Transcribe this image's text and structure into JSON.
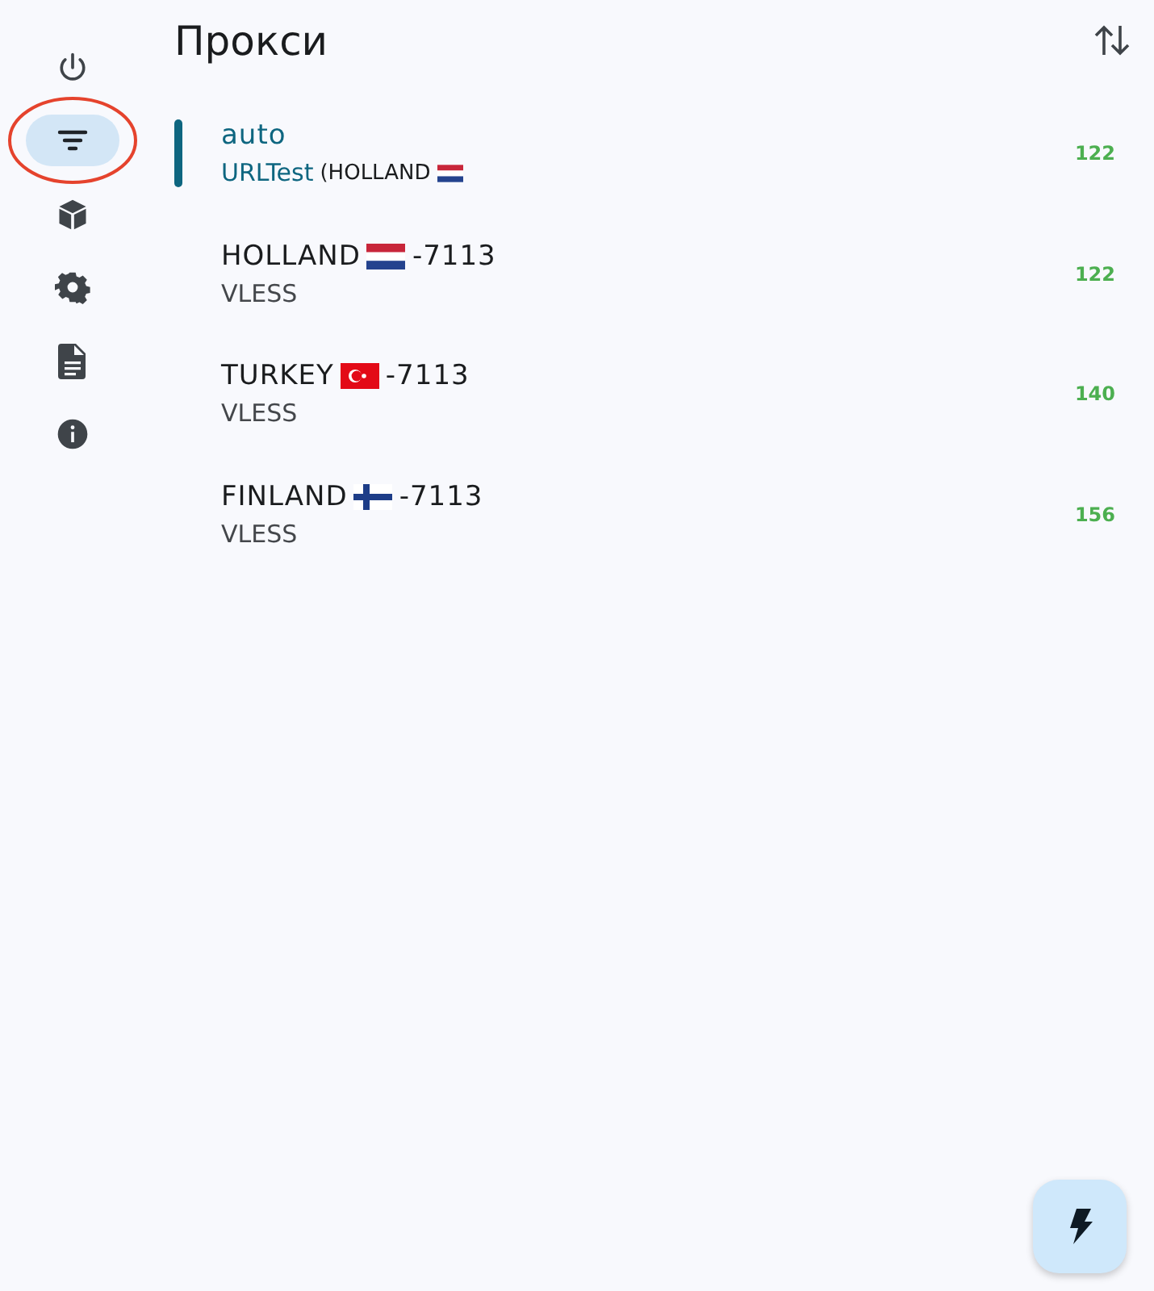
{
  "nav": [
    {
      "selected": false,
      "circled": false
    },
    {
      "selected": true,
      "circled": true
    },
    {
      "selected": false,
      "circled": false
    },
    {
      "selected": false,
      "circled": false
    },
    {
      "selected": false,
      "circled": false
    },
    {
      "selected": false,
      "circled": false
    }
  ],
  "title": "Прокси",
  "proxies": [
    {
      "name": "auto",
      "kind": "nl",
      "type": "URLTest",
      "detail": "(HOLLAND",
      "delay": "122",
      "selected": true
    },
    {
      "name": "HOLLAND",
      "kind": "nl",
      "suffix": "-7113",
      "type": "VLESS",
      "delay": "122",
      "selected": false
    },
    {
      "name": "TURKEY",
      "kind": "tr",
      "suffix": "-7113",
      "type": "VLESS",
      "delay": "140",
      "selected": false
    },
    {
      "name": "FINLAND",
      "kind": "fi",
      "suffix": "-7113",
      "type": "VLESS",
      "delay": "156",
      "selected": false
    }
  ]
}
